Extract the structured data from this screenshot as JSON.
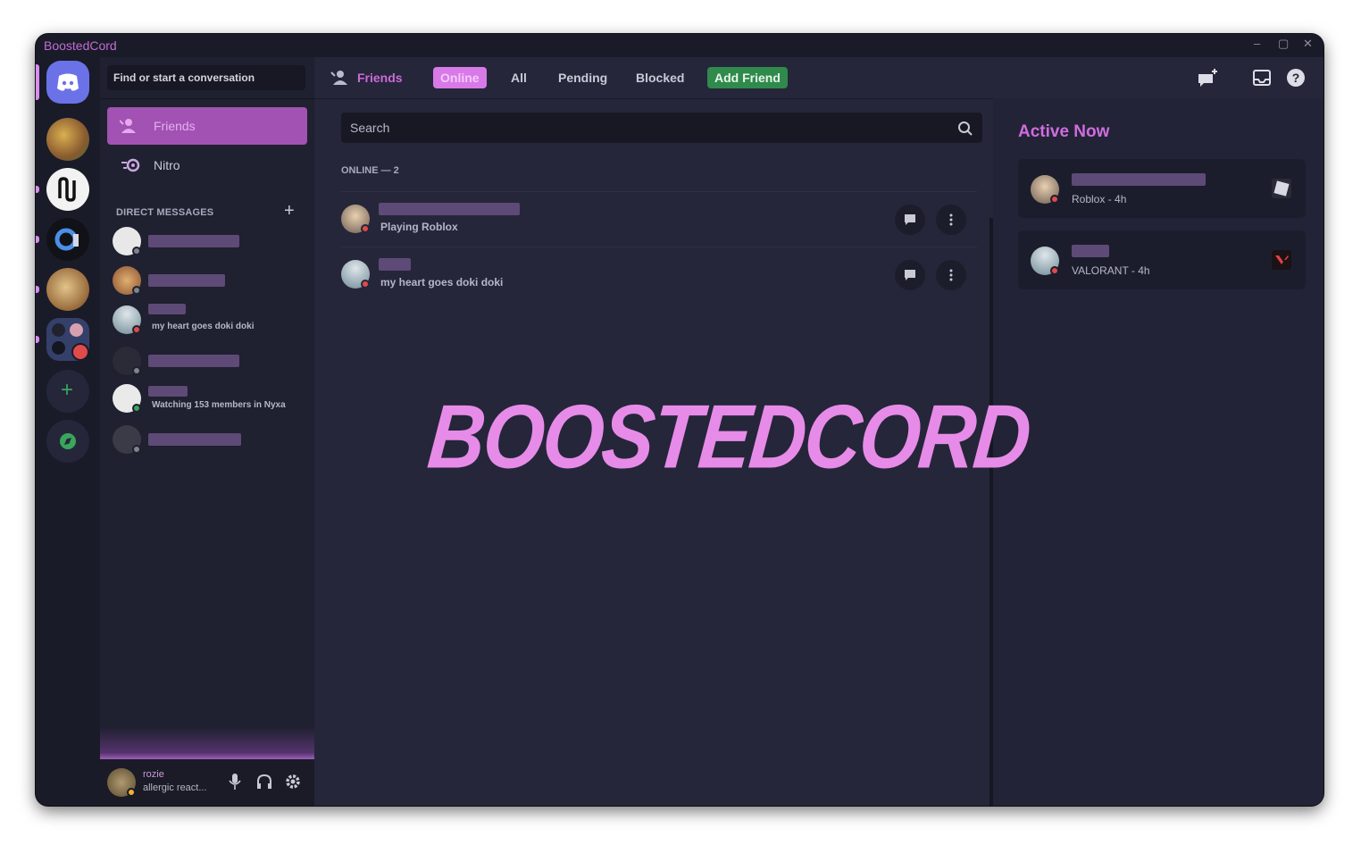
{
  "app": {
    "title": "BoostedCord",
    "controls": [
      "–",
      "▢",
      "✕"
    ]
  },
  "rail": {
    "servers": [
      "discord-home",
      "server-1",
      "server-2",
      "server-3",
      "server-4",
      "server-5",
      "add-server",
      "explore"
    ],
    "add_symbol": "+",
    "explore_symbol": "◉"
  },
  "sidebar": {
    "search_placeholder": "Find or start a conversation",
    "nav": [
      {
        "label": "Friends",
        "icon": "friends-icon"
      },
      {
        "label": "Nitro",
        "icon": "nitro-icon"
      }
    ],
    "dm_header": "DIRECT MESSAGES",
    "dm_add": "+",
    "dms": [
      {
        "sub": ""
      },
      {
        "sub": ""
      },
      {
        "sub": "my heart goes doki doki"
      },
      {
        "sub": ""
      },
      {
        "sub": "Watching 153 members in Nyxa"
      },
      {
        "sub": ""
      }
    ],
    "user": {
      "name": "rozie",
      "status": "allergic react..."
    }
  },
  "topbar": {
    "title": "Friends",
    "tabs": [
      "Online",
      "All",
      "Pending",
      "Blocked"
    ],
    "add_friend": "Add Friend",
    "icons": [
      "new-group-dm-icon",
      "inbox-icon",
      "help-icon"
    ]
  },
  "friends": {
    "search_placeholder": "Search",
    "online_header": "ONLINE — 2",
    "rows": [
      {
        "activity": "Playing Roblox"
      },
      {
        "activity": "my heart goes doki doki"
      }
    ]
  },
  "active_now": {
    "title": "Active Now",
    "cards": [
      {
        "activity": "Roblox - 4h",
        "game_icon": "roblox-icon"
      },
      {
        "activity": "VALORANT - 4h",
        "game_icon": "valorant-icon"
      }
    ]
  },
  "watermark": "BOOSTEDCORD",
  "colors": {
    "accent": "#d27be6",
    "add_friend": "#2f8a4c",
    "status_dnd": "#e04a4a"
  }
}
